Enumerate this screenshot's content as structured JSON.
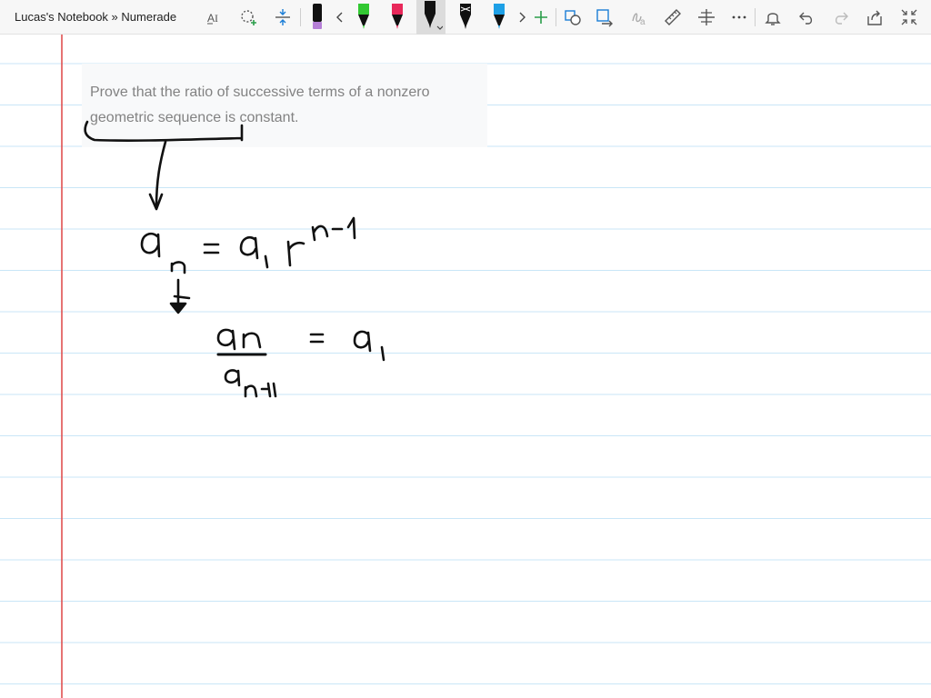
{
  "window": {
    "title": "Lucas's Notebook » Numerade"
  },
  "toolbar": {
    "tools": [
      {
        "name": "text-to-ink-icon"
      },
      {
        "name": "lasso-select-icon"
      },
      {
        "name": "add-space-icon"
      },
      {
        "name": "highlighter-purple",
        "color": "#9b59b6"
      },
      {
        "name": "scroll-left-icon"
      },
      {
        "name": "pen-green",
        "color": "#32c832"
      },
      {
        "name": "pen-red",
        "color": "#e8285a"
      },
      {
        "name": "pen-black-selected",
        "color": "#111111"
      },
      {
        "name": "pen-black-pattern",
        "color": "#111111"
      },
      {
        "name": "pen-blue",
        "color": "#1ea0e6"
      },
      {
        "name": "scroll-right-icon"
      },
      {
        "name": "add-pen-icon"
      },
      {
        "name": "ink-to-shape-icon"
      },
      {
        "name": "ink-to-text-icon"
      },
      {
        "name": "ink-to-math-icon"
      },
      {
        "name": "ruler-icon"
      },
      {
        "name": "positioning-icon"
      },
      {
        "name": "more-icon"
      },
      {
        "name": "bell-icon"
      },
      {
        "name": "undo-icon"
      },
      {
        "name": "redo-icon"
      },
      {
        "name": "share-icon"
      },
      {
        "name": "fullscreen-icon"
      }
    ]
  },
  "notebook": {
    "problem_text": "Prove that the ratio of successive terms of a nonzero geometric sequence is constant.",
    "margin_color": "#e05050",
    "rule_color": "#c9e6f7",
    "handwriting": [
      {
        "id": "formula-1",
        "latex": "a_n = a_1 r^{n-1}"
      },
      {
        "id": "formula-2",
        "latex": "\\frac{a_n}{a_{n+1}} = a_1"
      }
    ]
  }
}
